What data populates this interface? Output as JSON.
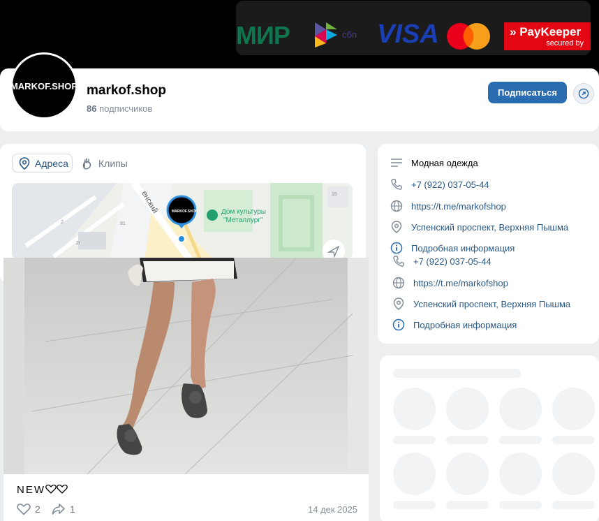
{
  "payments": {
    "mir": "МИР",
    "sbp": "сбп",
    "visa": "VISA",
    "paykeeper_title": "PayKeeper",
    "paykeeper_sub": "secured by"
  },
  "profile": {
    "avatar_text": "MARKOF.SHOP",
    "name": "markof.shop",
    "subscribers_count": "86",
    "subscribers_label": "подписчиков",
    "subscribe_button": "Подписаться"
  },
  "tabs": {
    "addresses": "Адреса",
    "clips": "Клипы"
  },
  "map": {
    "street": "енский",
    "poi_line1": "Дом культуры",
    "poi_line2": "\"Металлург\"",
    "marker_text": "MARKOF.SHOP",
    "n15": "15",
    "n2": "2",
    "n91": "91",
    "n2g": "2г"
  },
  "info": {
    "category": "Модная одежда",
    "phone": "+7 (922) 037-05-44",
    "link": "https://t.me/markofshop",
    "address": "Успенский проспект, Верхняя Пышма",
    "details": "Подробная информация"
  },
  "post": {
    "text": "NEW",
    "likes": "2",
    "shares": "1",
    "date": "14 дек 2025"
  },
  "colors": {
    "accent": "#2a6cb0",
    "link": "#2a5885",
    "muted": "#818c99"
  }
}
